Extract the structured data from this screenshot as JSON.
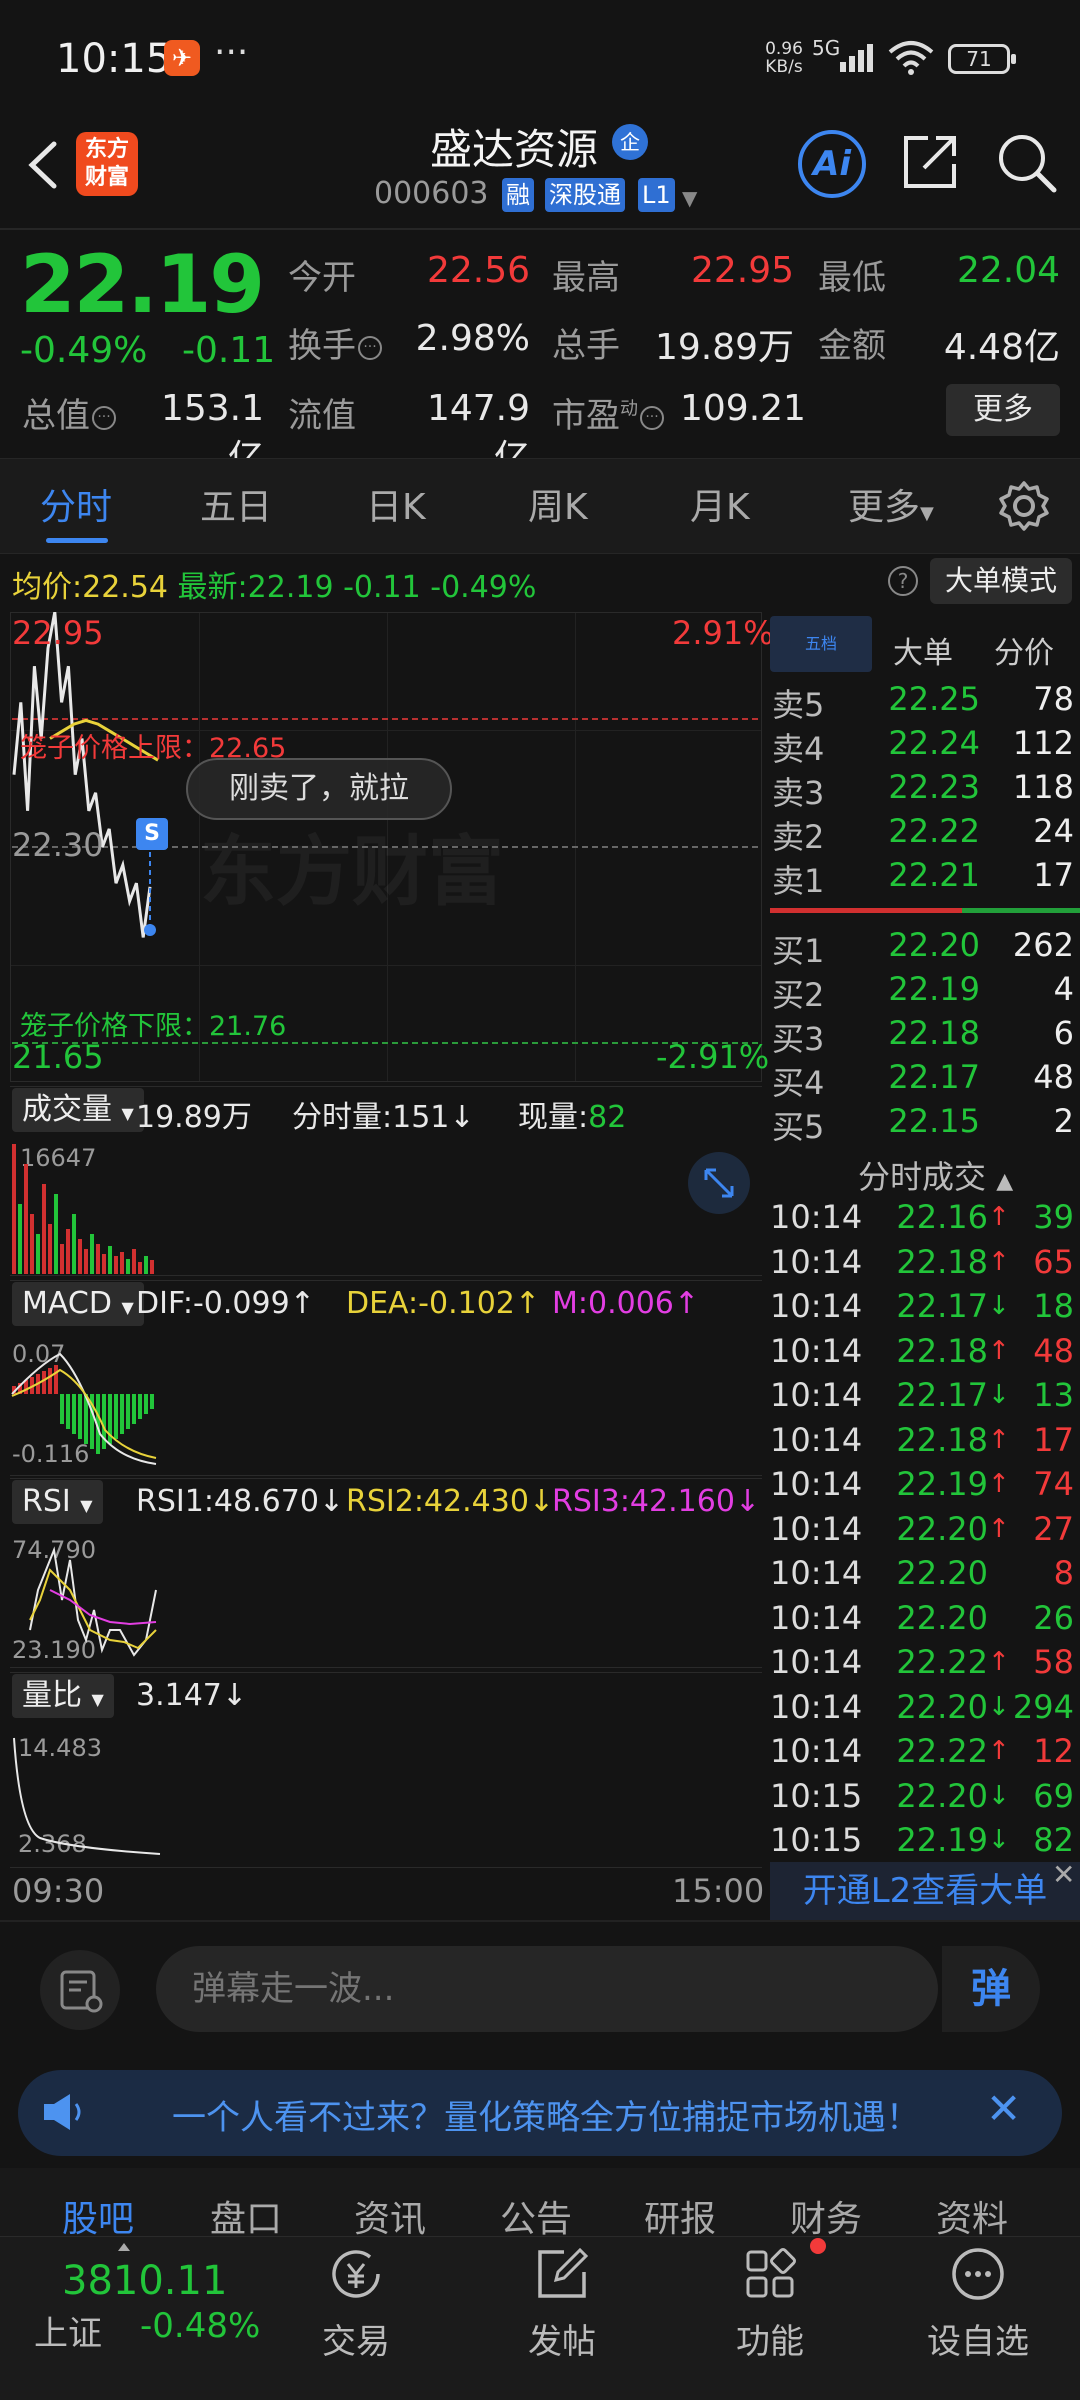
{
  "status_bar": {
    "time": "10:15",
    "app_icon_glyph": "✈",
    "more": "···",
    "net_speed_value": "0.96",
    "net_speed_unit": "KB/s",
    "network": "5G",
    "battery": "71"
  },
  "header": {
    "brand_line1": "东方",
    "brand_line2": "财富",
    "stock_name": "盛达资源",
    "enterprise_badge": "企",
    "stock_code": "000603",
    "tags": [
      "融",
      "深股通",
      "L1"
    ],
    "ai_label": "Ai"
  },
  "quote": {
    "last_price": "22.19",
    "change_pct": "-0.49%",
    "change_amt": "-0.11",
    "open_label": "今开",
    "open": "22.56",
    "high_label": "最高",
    "high": "22.95",
    "low_label": "最低",
    "low": "22.04",
    "turnover_label": "换手",
    "turnover": "2.98%",
    "total_hands_label": "总手",
    "total_hands": "19.89万",
    "amount_label": "金额",
    "amount": "4.48亿",
    "total_cap_label": "总值",
    "total_cap": "153.1亿",
    "float_cap_label": "流值",
    "float_cap": "147.9亿",
    "pe_label": "市盈",
    "pe_sup": "动",
    "pe": "109.21",
    "more_button": "更多"
  },
  "chart_tabs": [
    "分时",
    "五日",
    "日K",
    "周K",
    "月K",
    "更多"
  ],
  "avg_row": {
    "avg_label": "均价:",
    "avg_value": "22.54",
    "latest_label": "最新:",
    "latest_value": "22.19",
    "latest_change": "-0.11",
    "latest_pct": "-0.49%",
    "mode_button": "大单模式",
    "help_glyph": "?"
  },
  "main_chart": {
    "price_high": "22.95",
    "pct_high": "2.91%",
    "ref_price": "22.30",
    "price_low": "21.65",
    "pct_low": "-2.91%",
    "cage_upper": "笼子价格上限：22.65",
    "cage_lower": "笼子价格下限：21.76",
    "danmu_bubble": "刚卖了，就拉",
    "sell_marker": "S",
    "watermark": "东方财富",
    "start_time": "09:30",
    "end_time": "15:00",
    "price_series": [
      22.5,
      22.7,
      22.4,
      22.8,
      22.6,
      22.85,
      22.95,
      22.7,
      22.8,
      22.5,
      22.6,
      22.4,
      22.45,
      22.3,
      22.35,
      22.2,
      22.25,
      22.15,
      22.2,
      22.05,
      22.19
    ],
    "avg_series": [
      22.6,
      22.62,
      22.64,
      22.65,
      22.64,
      22.62,
      22.6,
      22.58,
      22.56,
      22.54
    ]
  },
  "order_book": {
    "tabs": [
      "五档",
      "大单",
      "分价"
    ],
    "asks": [
      {
        "label": "卖5",
        "price": "22.25",
        "vol": "78"
      },
      {
        "label": "卖4",
        "price": "22.24",
        "vol": "112"
      },
      {
        "label": "卖3",
        "price": "22.23",
        "vol": "118"
      },
      {
        "label": "卖2",
        "price": "22.22",
        "vol": "24"
      },
      {
        "label": "卖1",
        "price": "22.21",
        "vol": "17"
      }
    ],
    "bids": [
      {
        "label": "买1",
        "price": "22.20",
        "vol": "262"
      },
      {
        "label": "买2",
        "price": "22.19",
        "vol": "4"
      },
      {
        "label": "买3",
        "price": "22.18",
        "vol": "6"
      },
      {
        "label": "买4",
        "price": "22.17",
        "vol": "48"
      },
      {
        "label": "买5",
        "price": "22.15",
        "vol": "2"
      }
    ]
  },
  "ticks": {
    "title": "分时成交",
    "rows": [
      {
        "time": "10:14",
        "price": "22.16",
        "dir": "↑",
        "vol": "39",
        "vol_color": "#22c53a"
      },
      {
        "time": "10:14",
        "price": "22.18",
        "dir": "↑",
        "vol": "65",
        "vol_color": "#f23a3a"
      },
      {
        "time": "10:14",
        "price": "22.17",
        "dir": "↓",
        "vol": "18",
        "vol_color": "#22c53a"
      },
      {
        "time": "10:14",
        "price": "22.18",
        "dir": "↑",
        "vol": "48",
        "vol_color": "#f23a3a"
      },
      {
        "time": "10:14",
        "price": "22.17",
        "dir": "↓",
        "vol": "13",
        "vol_color": "#22c53a"
      },
      {
        "time": "10:14",
        "price": "22.18",
        "dir": "↑",
        "vol": "17",
        "vol_color": "#f23a3a"
      },
      {
        "time": "10:14",
        "price": "22.19",
        "dir": "↑",
        "vol": "74",
        "vol_color": "#f23a3a"
      },
      {
        "time": "10:14",
        "price": "22.20",
        "dir": "↑",
        "vol": "27",
        "vol_color": "#f23a3a"
      },
      {
        "time": "10:14",
        "price": "22.20",
        "dir": "",
        "vol": "8",
        "vol_color": "#f23a3a"
      },
      {
        "time": "10:14",
        "price": "22.20",
        "dir": "",
        "vol": "26",
        "vol_color": "#22c53a"
      },
      {
        "time": "10:14",
        "price": "22.22",
        "dir": "↑",
        "vol": "58",
        "vol_color": "#f23a3a"
      },
      {
        "time": "10:14",
        "price": "22.20",
        "dir": "↓",
        "vol": "294",
        "vol_color": "#22c53a"
      },
      {
        "time": "10:14",
        "price": "22.22",
        "dir": "↑",
        "vol": "12",
        "vol_color": "#f23a3a"
      },
      {
        "time": "10:15",
        "price": "22.20",
        "dir": "↓",
        "vol": "69",
        "vol_color": "#22c53a"
      },
      {
        "time": "10:15",
        "price": "22.19",
        "dir": "↓",
        "vol": "82",
        "vol_color": "#22c53a"
      }
    ],
    "l2_banner": "开通L2查看大单",
    "close_glyph": "✕"
  },
  "volume_panel": {
    "selector": "成交量",
    "total": "19.89万",
    "minute_label": "分时量:",
    "minute_value": "151↓",
    "current_label": "现量:",
    "current_value": "82",
    "axis_max": "16647"
  },
  "macd_panel": {
    "selector": "MACD",
    "dif": "DIF:-0.099↑",
    "dea": "DEA:-0.102↑",
    "m": "M:0.006↑",
    "axis_max": "0.07",
    "axis_min": "-0.116"
  },
  "rsi_panel": {
    "selector": "RSI",
    "rsi1": "RSI1:48.670↓",
    "rsi2": "RSI2:42.430↓",
    "rsi3": "RSI3:42.160↓",
    "axis_max": "74.790",
    "axis_min": "23.190"
  },
  "volratio_panel": {
    "selector": "量比",
    "value": "3.147↓",
    "axis_max": "14.483",
    "axis_min": "2.368"
  },
  "danmu": {
    "placeholder": "弹幕走一波...",
    "send_label": "弹"
  },
  "promo": {
    "text": "一个人看不过来？量化策略全方位捕捉市场机遇！",
    "close_glyph": "✕"
  },
  "section_tabs": [
    "股吧",
    "盘口",
    "资讯",
    "公告",
    "研报",
    "财务",
    "资料"
  ],
  "bottom_nav": {
    "index_value": "3810.11",
    "index_name": "上证",
    "index_change": "-0.48%",
    "items": [
      "交易",
      "发帖",
      "功能",
      "设自选"
    ]
  }
}
